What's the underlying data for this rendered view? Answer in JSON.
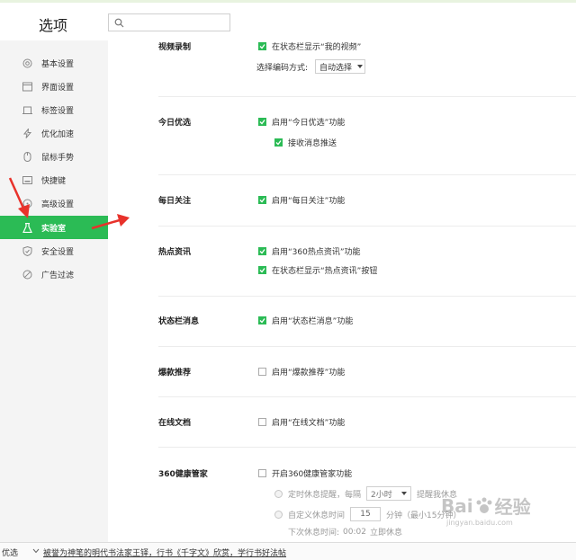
{
  "header": {
    "title": "选项",
    "search_placeholder": ""
  },
  "sidebar": {
    "items": [
      {
        "label": "基本设置",
        "icon": "settings-icon"
      },
      {
        "label": "界面设置",
        "icon": "window-icon"
      },
      {
        "label": "标签设置",
        "icon": "tab-icon"
      },
      {
        "label": "优化加速",
        "icon": "lightning-icon"
      },
      {
        "label": "鼠标手势",
        "icon": "mouse-icon"
      },
      {
        "label": "快捷键",
        "icon": "keyboard-icon"
      },
      {
        "label": "高级设置",
        "icon": "advanced-icon"
      },
      {
        "label": "实验室",
        "icon": "flask-icon",
        "active": true
      },
      {
        "label": "安全设置",
        "icon": "shield-icon"
      },
      {
        "label": "广告过滤",
        "icon": "block-icon"
      }
    ]
  },
  "sections": {
    "video": {
      "title": "视频录制",
      "opt1": "在状态栏显示“我的视频”",
      "opt1_checked": true,
      "encode_label": "选择编码方式:",
      "encode_value": "自动选择"
    },
    "today": {
      "title": "今日优选",
      "opt1": "启用“今日优选”功能",
      "opt1_checked": true,
      "opt2": "接收消息推送",
      "opt2_checked": true
    },
    "daily": {
      "title": "每日关注",
      "opt1": "启用“每日关注”功能",
      "opt1_checked": true
    },
    "hot": {
      "title": "热点资讯",
      "opt1": "启用“360热点资讯”功能",
      "opt1_checked": true,
      "opt2": "在状态栏显示“热点资讯”按钮",
      "opt2_checked": true
    },
    "statusbar": {
      "title": "状态栏消息",
      "opt1": "启用“状态栏消息”功能",
      "opt1_checked": true
    },
    "burst": {
      "title": "爆款推荐",
      "opt1": "启用“爆款推荐”功能",
      "opt1_checked": false
    },
    "docs": {
      "title": "在线文档",
      "opt1": "启用“在线文档”功能",
      "opt1_checked": false
    },
    "health": {
      "title": "360健康管家",
      "opt1": "开启360健康管家功能",
      "opt1_checked": false,
      "radio1_label": "定时休息提醒，每隔",
      "radio1_select": "2小时",
      "radio1_suffix": "提醒我休息",
      "radio2_label": "自定义休息时间",
      "radio2_value": "15",
      "radio2_suffix": "分钟（最小15分钟）",
      "next_label": "下次休息时间:",
      "next_time": "00:02",
      "next_action": "立即休息"
    }
  },
  "bottom": {
    "left_text": "优选",
    "news_text": "被誉为神笔的明代书法家王铎，行书《千字文》欣赏，学行书好法帖"
  },
  "watermark": {
    "brand": "Bai",
    "brand2": "经验",
    "url": "jingyan.baidu.com"
  },
  "colors": {
    "accent": "#2bbb55",
    "annotation": "#e8322b"
  }
}
